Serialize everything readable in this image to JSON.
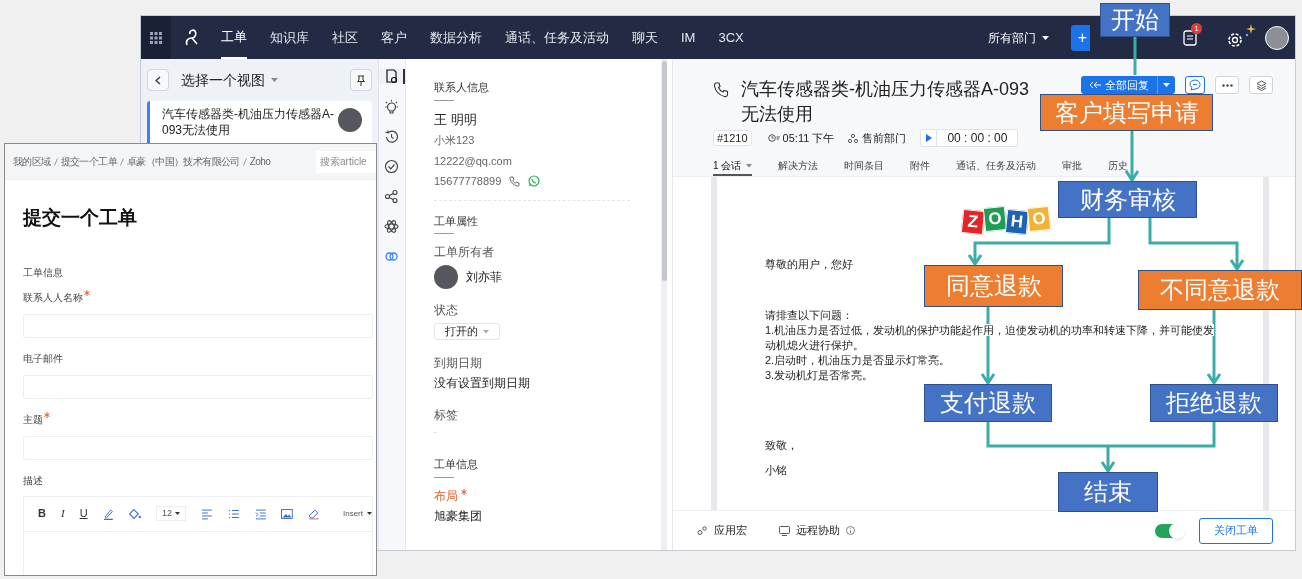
{
  "header": {
    "nav": [
      {
        "label": "工单",
        "selected": true
      },
      {
        "label": "知识库",
        "selected": false
      },
      {
        "label": "社区",
        "selected": false
      },
      {
        "label": "客户",
        "selected": false
      },
      {
        "label": "数据分析",
        "selected": false
      },
      {
        "label": "通话、任务及活动",
        "selected": false
      },
      {
        "label": "聊天",
        "selected": false
      },
      {
        "label": "IM",
        "selected": false
      },
      {
        "label": "3CX",
        "selected": false
      }
    ],
    "department": "所有部门",
    "add_button": "+",
    "notification_badge": "1"
  },
  "view_panel": {
    "title": "选择一个视图",
    "tickets": [
      {
        "title": "汽车传感器类-机油压力传感器A-093无法使用",
        "selected": true
      }
    ]
  },
  "side_rail": [
    {
      "kind": "ticket",
      "selected": true
    },
    {
      "kind": "bulb",
      "selected": false
    },
    {
      "kind": "history",
      "selected": false
    },
    {
      "kind": "check",
      "selected": false
    },
    {
      "kind": "share",
      "selected": false
    },
    {
      "kind": "atom",
      "selected": false
    },
    {
      "kind": "link",
      "selected": false
    }
  ],
  "contact": {
    "section": "联系人信息",
    "name": "王 明明",
    "company": "小米123",
    "email": "12222@qq.com",
    "phone": "15677778899"
  },
  "properties": {
    "section": "工单属性",
    "owner_label": "工单所有者",
    "owner": "刘亦菲",
    "status_label": "状态",
    "status": "打开的",
    "due_label": "到期日期",
    "due": "没有设置到期日期",
    "tags_label": "标签",
    "tags": "-"
  },
  "ticket_info": {
    "section": "工单信息",
    "fields": [
      {
        "label": "布局",
        "required": true,
        "value": "旭豪集团"
      }
    ]
  },
  "ticket": {
    "title": "汽车传感器类-机油压力传感器A-093无法使用",
    "reply_button": "全部回复",
    "id": "#1210",
    "time": "05:11 下午",
    "department": "售前部门",
    "timer": "00 : 00 : 00",
    "tabs": [
      {
        "label": "1 会话",
        "selected": true
      },
      {
        "label": "解决方法",
        "selected": false
      },
      {
        "label": "时间条目",
        "selected": false
      },
      {
        "label": "附件",
        "selected": false
      },
      {
        "label": "通话、任务及活动",
        "selected": false
      },
      {
        "label": "审批",
        "selected": false
      },
      {
        "label": "历史",
        "selected": false
      }
    ],
    "message": {
      "greeting": "尊敬的用户，您好",
      "body": [
        "请排查以下问题：",
        "1.机油压力是否过低，发动机的保护功能起作用，迫使发动机的功率和转速下降，并可能使发",
        "动机熄火进行保护。",
        "2.启动时，机油压力是否显示灯常亮。",
        "3.发动机灯是否常亮。"
      ],
      "closing": "致敬，",
      "signature": "小铭"
    },
    "footer": {
      "macro": "应用宏",
      "remote": "远程协助",
      "toggle_on": true,
      "close_button": "关闭工单"
    }
  },
  "form": {
    "breadcrumb": [
      "我的区域",
      "提交一个工单",
      "卓豪（中国）技术有限公司",
      "Zoho"
    ],
    "search_placeholder": "搜索article",
    "title": "提交一个工单",
    "section": "工单信息",
    "fields": [
      {
        "label": "联系人人名称",
        "required": true
      },
      {
        "label": "电子邮件",
        "required": false
      },
      {
        "label": "主题",
        "required": true
      }
    ],
    "description_label": "描述",
    "toolbar": [
      {
        "kind": "bold",
        "label": "B"
      },
      {
        "kind": "italic",
        "label": "I"
      },
      {
        "kind": "underline",
        "label": "U"
      },
      {
        "kind": "pen"
      },
      {
        "kind": "fill"
      },
      {
        "kind": "size",
        "label": "12"
      },
      {
        "kind": "align"
      },
      {
        "kind": "list"
      },
      {
        "kind": "indent"
      },
      {
        "kind": "image"
      },
      {
        "kind": "eraser"
      },
      {
        "kind": "insert",
        "label": "Insert"
      }
    ]
  },
  "flowchart": {
    "logo_letters": [
      "Z",
      "O",
      "H",
      "O"
    ],
    "nodes": [
      {
        "label": "开始",
        "color": "#4472c4"
      },
      {
        "label": "客户填写申请",
        "color": "#ed7d31"
      },
      {
        "label": "财务审核",
        "color": "#4472c4"
      },
      {
        "label": "同意退款",
        "color": "#ed7d31"
      },
      {
        "label": "不同意退款",
        "color": "#ed7d31"
      },
      {
        "label": "支付退款",
        "color": "#4472c4"
      },
      {
        "label": "拒绝退款",
        "color": "#4472c4"
      },
      {
        "label": "结束",
        "color": "#4472c4"
      }
    ]
  }
}
